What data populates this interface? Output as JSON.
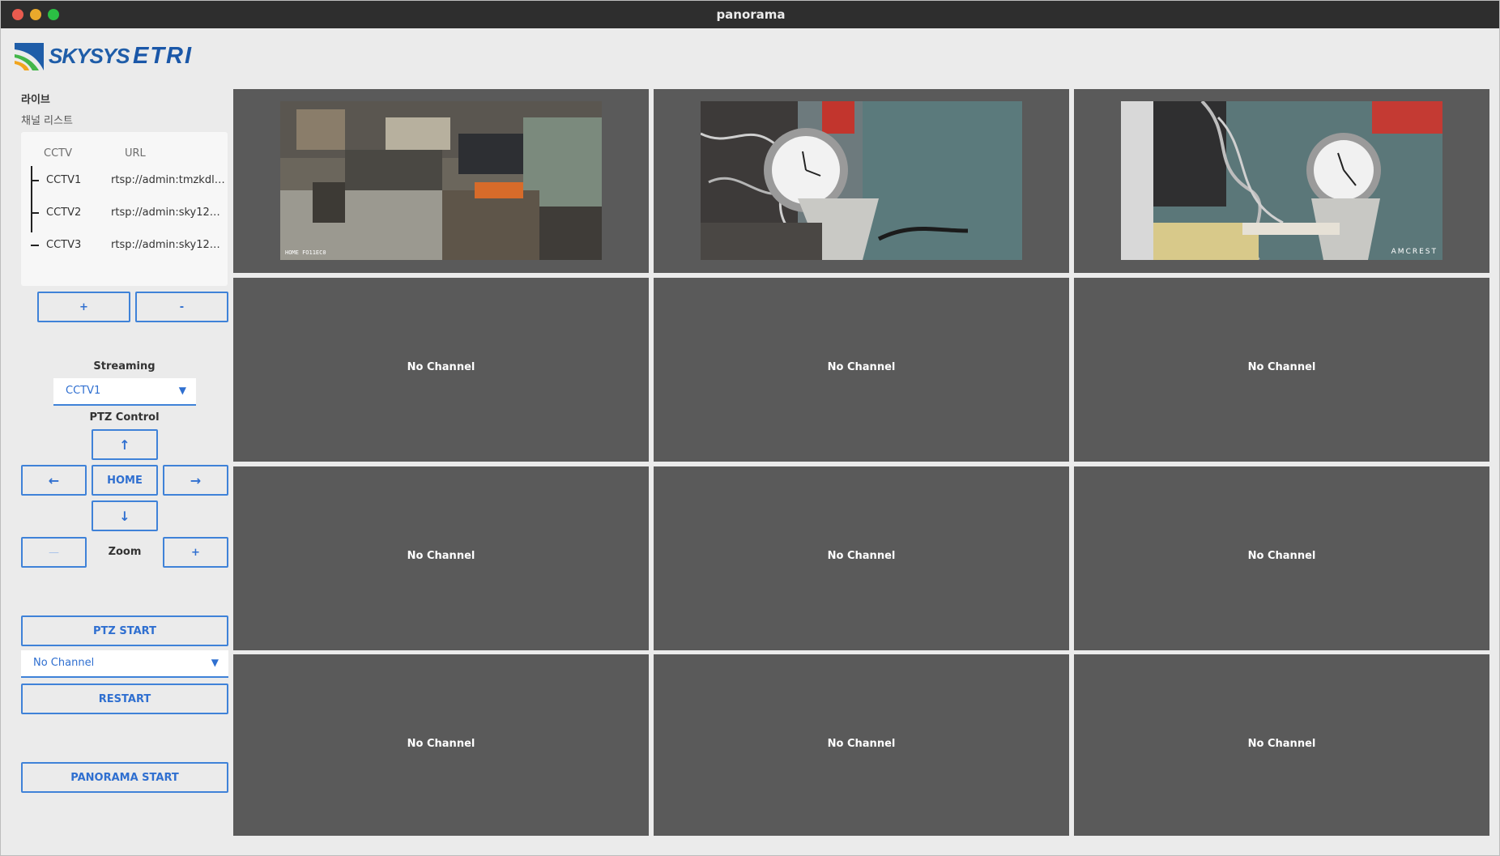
{
  "window": {
    "title": "panorama"
  },
  "brand": {
    "left": "SKYSYS",
    "right": "ETRI"
  },
  "sidebar": {
    "section": "라이브",
    "channel_list_label": "채널 리스트",
    "columns": {
      "cctv": "CCTV",
      "url": "URL"
    },
    "channels": [
      {
        "name": "CCTV1",
        "url": "rtsp://admin:tmzkdl1..."
      },
      {
        "name": "CCTV2",
        "url": "rtsp://admin:sky123!!..."
      },
      {
        "name": "CCTV3",
        "url": "rtsp://admin:sky123!!..."
      }
    ],
    "add_label": "+",
    "remove_label": "-",
    "streaming_label": "Streaming",
    "streaming_selected": "CCTV1",
    "ptz_label": "PTZ Control",
    "up_label": "↑",
    "left_label": "←",
    "home_label": "HOME",
    "right_label": "→",
    "down_label": "↓",
    "zoom_out_label": "—",
    "zoom_label": "Zoom",
    "zoom_in_label": "+",
    "ptz_start_label": "PTZ START",
    "restart_channel_selected": "No Channel",
    "restart_label": "RESTART",
    "panorama_start_label": "PANORAMA START"
  },
  "grid": {
    "no_channel": "No Channel",
    "feed_overlays": {
      "cctv1_bottom": "HOME FO11EC0",
      "cctv3_brand": "AMCREST"
    }
  },
  "colors": {
    "accent": "#3f82d8",
    "tile": "#5a5a5a",
    "background": "#ebebeb",
    "titlebar": "#2e2e2e"
  }
}
